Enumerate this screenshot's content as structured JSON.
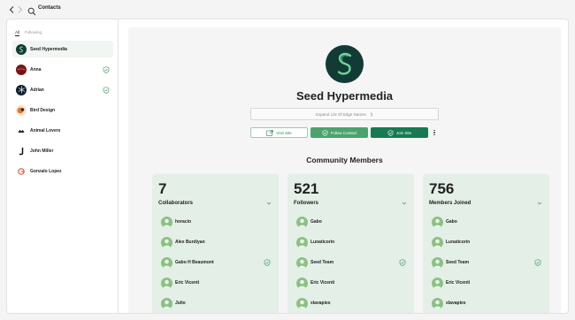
{
  "header": {
    "title": "Contacts"
  },
  "sidebar": {
    "tabs": [
      {
        "label": "All"
      },
      {
        "label": "Following"
      }
    ],
    "contacts": [
      {
        "name": "Seed Hypermedia",
        "avatar": "seed-logo",
        "verified": false,
        "active": true
      },
      {
        "name": "Anna",
        "avatar": "red-avatar",
        "verified": true,
        "active": false
      },
      {
        "name": "Adrian",
        "avatar": "snowflake-avatar",
        "verified": true,
        "active": false
      },
      {
        "name": "Bird Design",
        "avatar": "bird-avatar",
        "verified": false,
        "active": false
      },
      {
        "name": "Animal Lovers",
        "avatar": "paw-avatar",
        "verified": false,
        "active": false
      },
      {
        "name": "John Miller",
        "avatar": "letter-j-avatar",
        "verified": false,
        "active": false
      },
      {
        "name": "Gonzalo Lopez",
        "avatar": "g-logo-avatar",
        "verified": false,
        "active": false
      }
    ]
  },
  "profile": {
    "title": "Seed Hypermedia",
    "expand_label": "Expand List Of Edge Names",
    "visit_label": "Visit Site",
    "follow_label": "Follow Contact",
    "join_label": "Join Site"
  },
  "community": {
    "title": "Community Members",
    "cards": [
      {
        "count": "7",
        "label": "Collaborators",
        "members": [
          {
            "name": "horacio",
            "verified": false
          },
          {
            "name": "Alex Burdiyan",
            "verified": false
          },
          {
            "name": "Gabo H Beaumont",
            "verified": true
          },
          {
            "name": "Eric Vicenti",
            "verified": false
          },
          {
            "name": "Julio",
            "verified": false
          }
        ]
      },
      {
        "count": "521",
        "label": "Followers",
        "members": [
          {
            "name": "Gabo",
            "verified": false
          },
          {
            "name": "Lunaticorin",
            "verified": false
          },
          {
            "name": "Seed Team",
            "verified": true
          },
          {
            "name": "Eric Vicenti",
            "verified": false
          },
          {
            "name": "xlavapies",
            "verified": false
          }
        ]
      },
      {
        "count": "756",
        "label": "Members Joined",
        "members": [
          {
            "name": "Gabo",
            "verified": false
          },
          {
            "name": "Lunaticorin",
            "verified": false
          },
          {
            "name": "Seed Team",
            "verified": true
          },
          {
            "name": "Eric Vicenti",
            "verified": false
          },
          {
            "name": "xlavapies",
            "verified": false
          }
        ]
      }
    ]
  },
  "colors": {
    "accent": "#4aa36c",
    "accent_dark": "#167a52",
    "logo_bg": "#123b36",
    "card_bg": "#e4efe7"
  }
}
